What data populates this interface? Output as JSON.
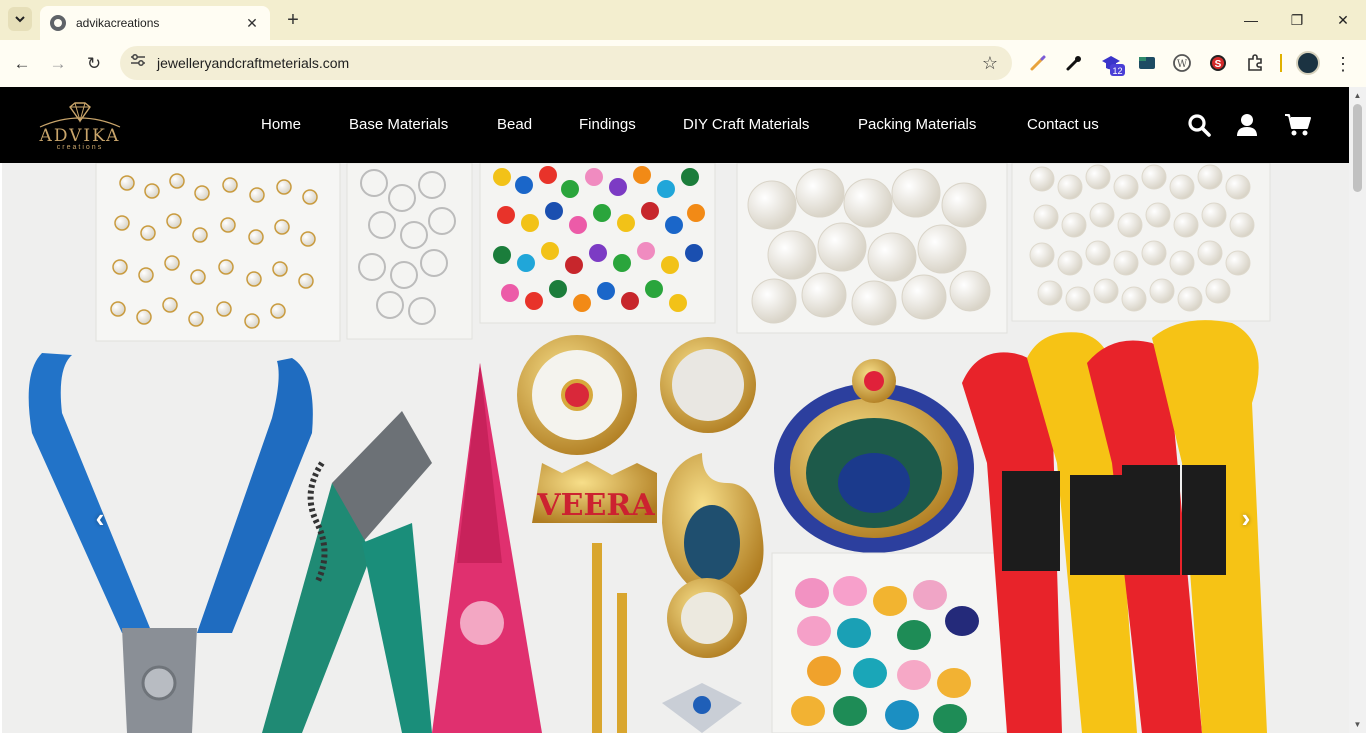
{
  "browser": {
    "tab_title": "advikacreations",
    "url": "jewelleryandcraftmeterials.com",
    "new_tab_symbol": "+",
    "close_symbol": "✕",
    "minimize_symbol": "—",
    "restore_symbol": "❐",
    "window_close_symbol": "✕",
    "back_symbol": "←",
    "forward_symbol": "→",
    "reload_symbol": "↻",
    "star_symbol": "☆",
    "menu_symbol": "⋮",
    "extension_badge": "12",
    "extensions": [
      "pen-icon",
      "eyedropper-icon",
      "graduation-cap-icon",
      "folder-icon",
      "wordpress-icon",
      "s-logo-icon",
      "puzzle-icon"
    ]
  },
  "site": {
    "logo_text": "ADVIKA",
    "logo_sub": "creations",
    "nav": [
      "Home",
      "Base Materials",
      "Bead",
      "Findings",
      "DIY Craft Materials",
      "Packing Materials",
      "Contact us"
    ],
    "header_icons": [
      "search-icon",
      "user-icon",
      "cart-icon"
    ],
    "colors": {
      "header_bg": "#000000",
      "logo_gold": "#c9a56b",
      "nav_text": "#ffffff"
    }
  },
  "hero": {
    "prev_symbol": "‹",
    "next_symbol": "›",
    "banner_text": "VEERA"
  }
}
